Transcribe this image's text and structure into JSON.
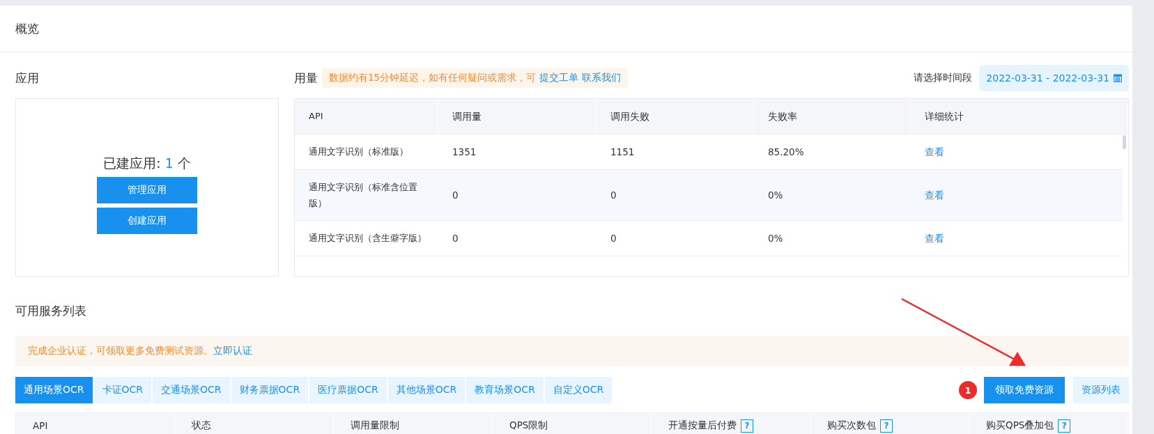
{
  "page_title": "概览",
  "apps": {
    "heading": "应用",
    "count_label": "已建应用:",
    "count": "1",
    "count_unit": "个",
    "buttons": [
      "管理应用",
      "创建应用"
    ]
  },
  "usage": {
    "heading": "用量",
    "notice": "数据约有15分钟延迟，如有任何疑问或需求，可",
    "notice_links": [
      "提交工单",
      "联系我们"
    ],
    "date_label": "请选择时间段",
    "date_range": "2022-03-31 - 2022-03-31",
    "columns": [
      "API",
      "调用量",
      "调用失败",
      "失败率",
      "详细统计"
    ],
    "rows": [
      {
        "api": "通用文字识别（标准版）",
        "calls": "1351",
        "failures": "1151",
        "failure_rate": "85.20%",
        "detail": "查看",
        "highlighted": false
      },
      {
        "api": "通用文字识别（标准含位置版）",
        "calls": "0",
        "failures": "0",
        "failure_rate": "0%",
        "detail": "查看",
        "highlighted": true
      },
      {
        "api": "通用文字识别（含生僻字版）",
        "calls": "0",
        "failures": "0",
        "failure_rate": "0%",
        "detail": "查看",
        "highlighted": false
      }
    ]
  },
  "services": {
    "heading": "可用服务列表",
    "notice": "完成企业认证，可领取更多免费测试资源。",
    "notice_link": "立即认证",
    "tabs": [
      {
        "label": "通用场景OCR",
        "selected": true
      },
      {
        "label": "卡证OCR",
        "selected": false
      },
      {
        "label": "交通场景OCR",
        "selected": false
      },
      {
        "label": "财务票据OCR",
        "selected": false
      },
      {
        "label": "医疗票据OCR",
        "selected": false
      },
      {
        "label": "其他场景OCR",
        "selected": false
      },
      {
        "label": "教育场景OCR",
        "selected": false
      },
      {
        "label": "自定义OCR",
        "selected": false
      }
    ],
    "annotation_badge": "1",
    "primary_button": "领取免费资源",
    "secondary_button": "资源列表",
    "columns": [
      {
        "label": "API"
      },
      {
        "label": "状态"
      },
      {
        "label": "调用量限制"
      },
      {
        "label": "QPS限制"
      },
      {
        "label": "开通按量后付费",
        "help": "?"
      },
      {
        "label": "购买次数包",
        "help": "?"
      },
      {
        "label": "购买QPS叠加包",
        "help": "?"
      }
    ]
  }
}
